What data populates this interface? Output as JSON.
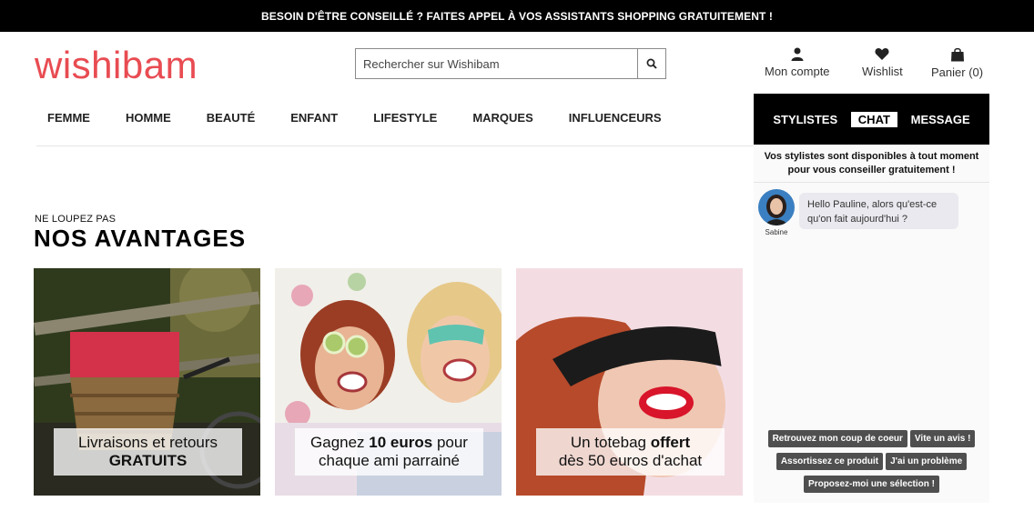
{
  "topbar": {
    "text": "BESOIN D'ÊTRE CONSEILLÉ ? FAITES APPEL À VOS ASSISTANTS SHOPPING GRATUITEMENT !"
  },
  "brand": {
    "name": "wishibam",
    "color": "#e84c52"
  },
  "search": {
    "placeholder": "Rechercher sur Wishibam",
    "icon": "search-icon"
  },
  "user_actions": [
    {
      "label": "Mon compte",
      "icon": "user-icon"
    },
    {
      "label": "Wishlist",
      "icon": "heart-icon"
    },
    {
      "label": "Panier (0)",
      "icon": "shopping-bag-icon"
    }
  ],
  "nav": [
    "FEMME",
    "HOMME",
    "BEAUTÉ",
    "ENFANT",
    "LIFESTYLE",
    "MARQUES",
    "INFLUENCEURS"
  ],
  "section": {
    "kicker": "NE LOUPEZ PAS",
    "title": "NOS AVANTAGES"
  },
  "cards": [
    {
      "line1": "Livraisons et retours",
      "line2_bold": "GRATUITS"
    },
    {
      "line1_pre": "Gagnez ",
      "line1_bold": "10 euros",
      "line1_post": " pour",
      "line2": "chaque ami parrainé"
    },
    {
      "line1_pre": "Un totebag ",
      "line1_bold": "offert",
      "line2": "dès 50 euros d'achat"
    }
  ],
  "chat": {
    "tabs": [
      "STYLISTES",
      "CHAT",
      "MESSAGE"
    ],
    "active_tab": "CHAT",
    "intro": "Vos stylistes sont disponibles à tout moment pour vous conseiller gratuitement !",
    "agent_name": "Sabine",
    "message": "Hello Pauline, alors qu'est-ce qu'on fait aujourd'hui ?",
    "quick_replies": [
      [
        "Retrouvez mon coup de coeur",
        "Vite un avis !"
      ],
      [
        "Assortissez ce produit",
        "J'ai un problème"
      ],
      [
        "Proposez-moi une sélection !"
      ]
    ]
  },
  "colors": {
    "topbar_bg": "#000000",
    "quick_reply_bg": "#4f4f4f",
    "bubble_bg": "#e9e9ef"
  }
}
